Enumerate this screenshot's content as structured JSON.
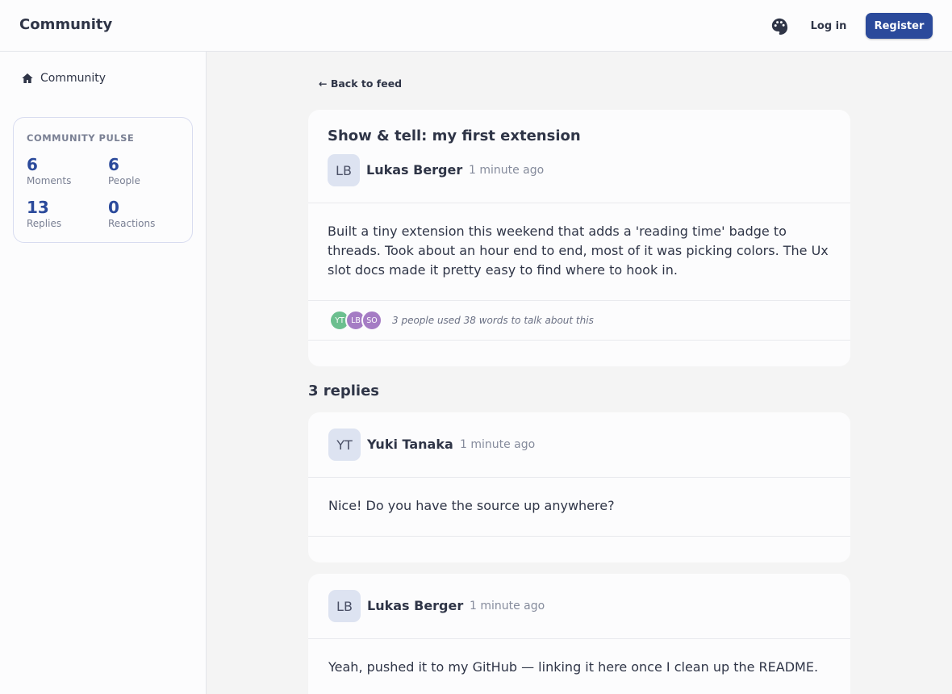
{
  "header": {
    "brand": "Community",
    "login_label": "Log in",
    "register_label": "Register",
    "accent_color": "#2b4a9b"
  },
  "sidebar": {
    "nav_item": {
      "label": "Community",
      "icon": "home-icon"
    },
    "pulse": {
      "title": "COMMUNITY PULSE",
      "stats": [
        {
          "value": "6",
          "label": "Moments"
        },
        {
          "value": "6",
          "label": "People"
        },
        {
          "value": "13",
          "label": "Replies"
        },
        {
          "value": "0",
          "label": "Reactions"
        }
      ]
    }
  },
  "main": {
    "back_label": "← Back to feed",
    "post": {
      "title": "Show & tell: my first extension",
      "author_initials": "LB",
      "author_name": "Lukas Berger",
      "time": "1 minute ago",
      "body": "Built a tiny extension this weekend that adds a 'reading time' badge to threads. Took about an hour end to end, most of it was picking colors. The Ux slot docs made it pretty easy to find where to hook in.",
      "participants": [
        {
          "initials": "YT",
          "color": "#6cbf8f"
        },
        {
          "initials": "LB",
          "color": "#a57cc4"
        },
        {
          "initials": "SO",
          "color": "#a57cc4"
        }
      ],
      "summary": "3 people used 38 words to talk about this"
    },
    "replies_heading": "3 replies",
    "replies": [
      {
        "author_initials": "YT",
        "author_name": "Yuki Tanaka",
        "time": "1 minute ago",
        "body": "Nice! Do you have the source up anywhere?"
      },
      {
        "author_initials": "LB",
        "author_name": "Lukas Berger",
        "time": "1 minute ago",
        "body": "Yeah, pushed it to my GitHub — linking it here once I clean up the README."
      }
    ]
  }
}
